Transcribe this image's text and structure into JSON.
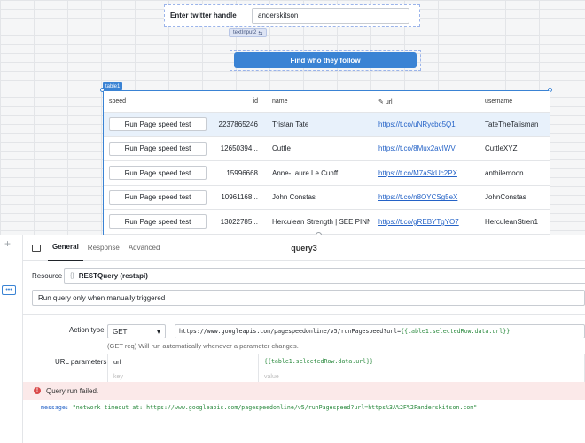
{
  "canvas": {
    "twitter_label": "Enter twitter handle",
    "twitter_value": "anderskitson",
    "text_input_badge": "textInput2",
    "find_button": "Find who they follow",
    "table_badge": "table1"
  },
  "table": {
    "headers": {
      "speed": "speed",
      "id": "id",
      "name": "name",
      "url": "url",
      "username": "username"
    },
    "rows": [
      {
        "button": "Run Page speed test",
        "id": "2237865246",
        "name": "Tristan Tate",
        "url": "https://t.co/uNRycbc5Q1",
        "username": "TateTheTalisman"
      },
      {
        "button": "Run Page speed test",
        "id": "12650394...",
        "name": "Cuttle",
        "url": "https://t.co/8Mux2avIWV",
        "username": "CuttleXYZ"
      },
      {
        "button": "Run Page speed test",
        "id": "15996668",
        "name": "Anne-Laure Le Cunff",
        "url": "https://t.co/M7aSkUc2PX",
        "username": "anthilemoon"
      },
      {
        "button": "Run Page speed test",
        "id": "10961168...",
        "name": "John Constas",
        "url": "https://t.co/n8OYCSg5eX",
        "username": "JohnConstas"
      },
      {
        "button": "Run Page speed test",
        "id": "13022785...",
        "name": "Herculean Strength | SEE PINN...",
        "url": "https://t.co/gREBYTgYO7",
        "username": "HerculeanStren1"
      }
    ]
  },
  "panel": {
    "tabs": [
      "General",
      "Response",
      "Advanced"
    ],
    "query_name": "query3",
    "resource_label": "Resource",
    "resource_icon": "{}",
    "resource_value": "RESTQuery (restapi)",
    "trigger_text": "Run query only when manually triggered",
    "action_label": "Action type",
    "method": "GET",
    "url_prefix": "https://www.googleapis.com/pagespeedonline/v5/runPagespeed?url=",
    "url_template": "{{table1.selectedRow.data.url}}",
    "hint": "(GET req) Will run automatically whenever a parameter changes.",
    "url_params_label": "URL parameters",
    "param_key": "url",
    "param_value": "{{table1.selectedRow.data.url}}",
    "key_placeholder": "key",
    "value_placeholder": "value",
    "error_title": "Query run failed.",
    "error_key": "message:",
    "error_value": "\"network timeout at: https://www.googleapis.com/pagespeedonline/v5/runPagespeed?url=https%3A%2F%2Fanderskitson.com\""
  },
  "colors": {
    "accent": "#3a83d4",
    "error_bg": "#fbe9e9",
    "template_green": "#2a8a3e",
    "link_blue": "#2563c7"
  },
  "icons": {
    "plus": "plus-icon",
    "more": "more-icon",
    "panel": "panel-toggle-icon",
    "error": "error-icon",
    "link": "link-icon"
  }
}
